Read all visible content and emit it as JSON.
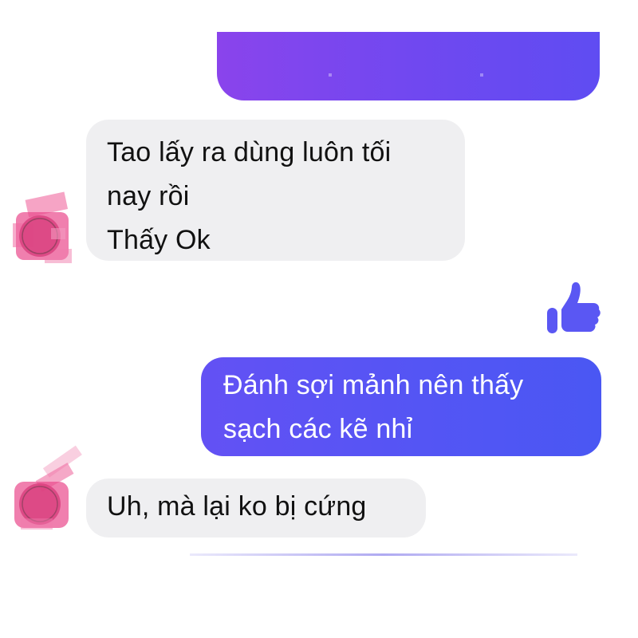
{
  "messages": [
    {
      "from": "other",
      "lines": [
        "Tao lấy ra dùng luôn tối",
        "nay rồi",
        "Thấy Ok"
      ]
    },
    {
      "from": "me",
      "lines": [
        "Đánh sợi mảnh nên thấy",
        "sạch các kẽ nhỉ"
      ]
    },
    {
      "from": "other",
      "lines": [
        "Uh, mà lại ko bị cứng"
      ]
    }
  ],
  "reactions": {
    "like_icon": "thumbs-up-icon"
  },
  "colors": {
    "incoming_bubble": "#efeff1",
    "outgoing_bubble": "#5455f4",
    "top_bubble": "#7148f0",
    "like_icon": "#5a57f3",
    "avatar_blur": "#e8478a"
  }
}
